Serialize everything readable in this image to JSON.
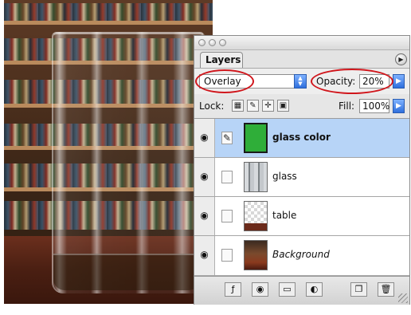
{
  "palette": {
    "tab_label": "Layers",
    "menu_icon": "flyout-menu-icon"
  },
  "options": {
    "blend_mode": "Overlay",
    "opacity_label": "Opacity:",
    "opacity_value": "20%",
    "highlight_color": "#d0161c"
  },
  "lock": {
    "label": "Lock:",
    "icons": [
      "lock-transparency-icon",
      "lock-image-icon",
      "lock-position-icon",
      "lock-all-icon"
    ],
    "fill_label": "Fill:",
    "fill_value": "100%"
  },
  "layers": [
    {
      "name": "glass color",
      "selected": true,
      "visible": true,
      "linked": true,
      "thumb_color": "#2fae39"
    },
    {
      "name": "glass",
      "selected": false,
      "visible": true,
      "linked": false
    },
    {
      "name": "table",
      "selected": false,
      "visible": true,
      "linked": false
    },
    {
      "name": "Background",
      "selected": false,
      "visible": true,
      "linked": false
    }
  ],
  "bottom_bar": {
    "buttons": [
      "layer-style-icon",
      "layer-mask-icon",
      "new-group-icon",
      "adjustment-layer-icon",
      "new-layer-icon",
      "trash-icon"
    ]
  },
  "colors": {
    "selected_row": "#b7d4f7",
    "accent_blue": "#2f6fdd"
  }
}
